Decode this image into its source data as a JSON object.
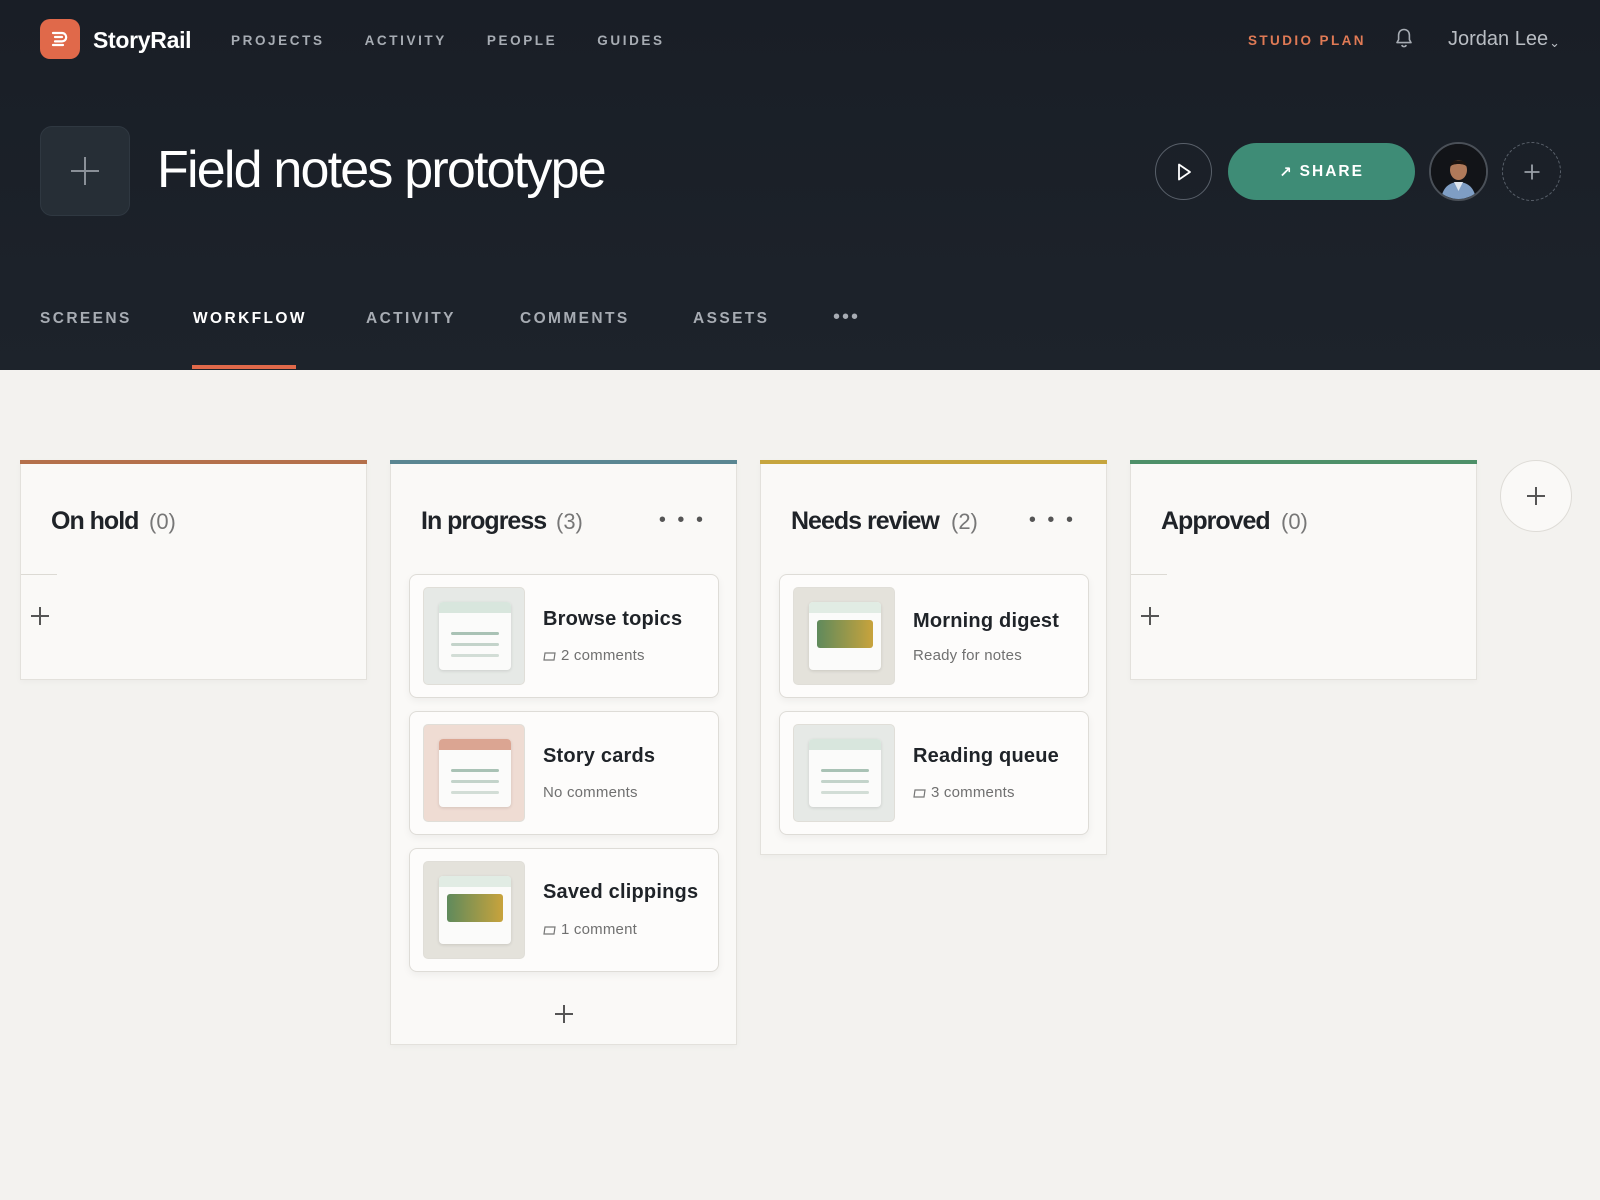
{
  "app": {
    "name": "StoryRail",
    "brand_color": "#e0694a",
    "accent_color": "#3e8c76"
  },
  "topnav": {
    "items": [
      "PROJECTS",
      "ACTIVITY",
      "PEOPLE",
      "GUIDES"
    ],
    "plan_label": "STUDIO PLAN",
    "user_name": "Jordan Lee"
  },
  "project": {
    "title": "Field notes prototype",
    "share_label": "SHARE"
  },
  "tabs": {
    "items": [
      "SCREENS",
      "WORKFLOW",
      "ACTIVITY",
      "COMMENTS",
      "ASSETS"
    ],
    "active": "WORKFLOW",
    "more_label": "•••"
  },
  "board": {
    "columns": [
      {
        "title": "On hold",
        "count": "(0)",
        "color": "#b4704b",
        "cards": []
      },
      {
        "title": "In progress",
        "count": "(3)",
        "color": "#5a8692",
        "menu_label": "• • •",
        "cards": [
          {
            "title": "Browse topics",
            "subtitle": "2 comments",
            "thumb_icon": "list-thumbnail-icon"
          },
          {
            "title": "Story cards",
            "subtitle": "No comments",
            "thumb_icon": "list-thumbnail-icon"
          },
          {
            "title": "Saved clippings",
            "subtitle": "1 comment",
            "thumb_icon": "image-thumbnail-icon"
          }
        ]
      },
      {
        "title": "Needs review",
        "count": "(2)",
        "color": "#c6a53e",
        "menu_label": "• • •",
        "cards": [
          {
            "title": "Morning digest",
            "subtitle": "Ready for notes",
            "thumb_icon": "image-thumbnail-icon"
          },
          {
            "title": "Reading queue",
            "subtitle": "3 comments",
            "thumb_icon": "list-thumbnail-icon"
          }
        ]
      },
      {
        "title": "Approved",
        "count": "(0)",
        "color": "#4e9069",
        "cards": []
      }
    ]
  }
}
